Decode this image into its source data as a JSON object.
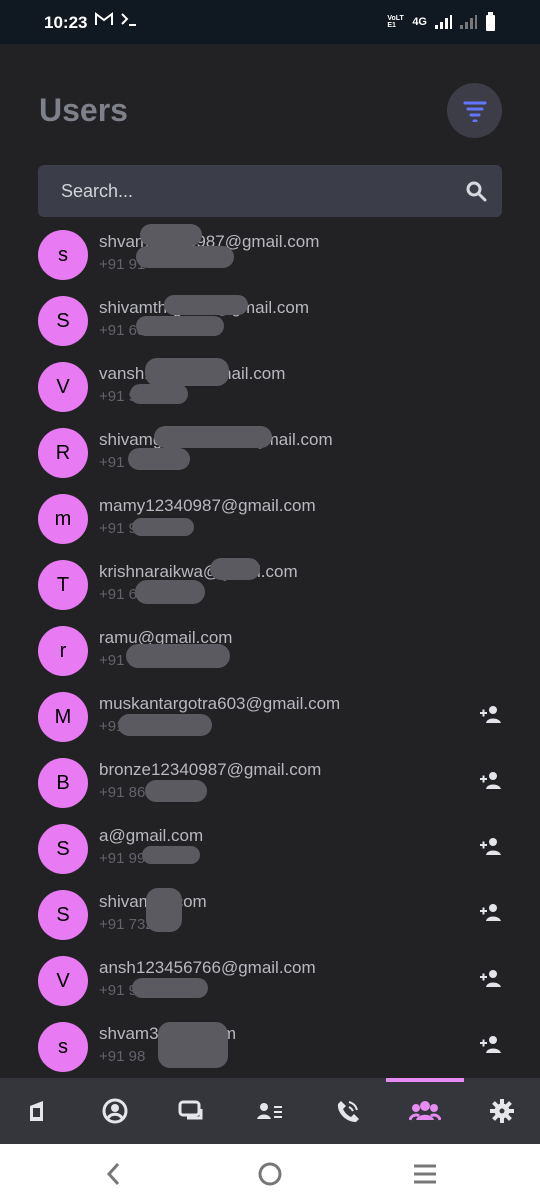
{
  "status": {
    "time": "10:23",
    "network": "4G",
    "lte_label": "VoLTE1"
  },
  "header": {
    "title": "Users"
  },
  "search": {
    "placeholder": "Search..."
  },
  "users": [
    {
      "initial": "s",
      "email": "shvam12340987@gmail.com",
      "phone": "+91 91"
    },
    {
      "initial": "S",
      "email": "shivamthrghost@gmail.com",
      "phone": "+91 6865"
    },
    {
      "initial": "V",
      "email": "vanshk4784@gmail.com",
      "phone": "+91 9161"
    },
    {
      "initial": "R",
      "email": "shivamg12340987@gmail.com",
      "phone": "+91 66864"
    },
    {
      "initial": "m",
      "email": "mamy12340987@gmail.com",
      "phone": "+91 95958"
    },
    {
      "initial": "T",
      "email": "krishnaraikwa@gmail.com",
      "phone": "+91 65658"
    },
    {
      "initial": "r",
      "email": "ramu@gmail.com",
      "phone": "+91"
    },
    {
      "initial": "M",
      "email": "muskantargotra603@gmail.com",
      "phone": "+91 6094",
      "add_contact": true
    },
    {
      "initial": "B",
      "email": "bronze12340987@gmail.com",
      "phone": "+91 866",
      "add_contact": true
    },
    {
      "initial": "S",
      "email": "a@gmail.com",
      "phone": "+91 99655",
      "add_contact": true
    },
    {
      "initial": "S",
      "email": "shivamail.com",
      "phone": "+91 732052",
      "add_contact": true
    },
    {
      "initial": "V",
      "email": "ansh123456766@gmail.com",
      "phone": "+91 938",
      "add_contact": true
    },
    {
      "initial": "s",
      "email": "shvam3gmail.com",
      "phone": "+91 98",
      "add_contact": true
    }
  ],
  "bottom_nav": {
    "items": [
      "home-icon",
      "profile-icon",
      "chat-icon",
      "contacts-icon",
      "calls-icon",
      "users-icon",
      "settings-icon"
    ],
    "active": "users-icon",
    "accent": "#e68bf1"
  },
  "colors": {
    "avatar": "#e87af4",
    "background": "#222224",
    "search": "#3b3d48",
    "filter": "#6272ff"
  }
}
